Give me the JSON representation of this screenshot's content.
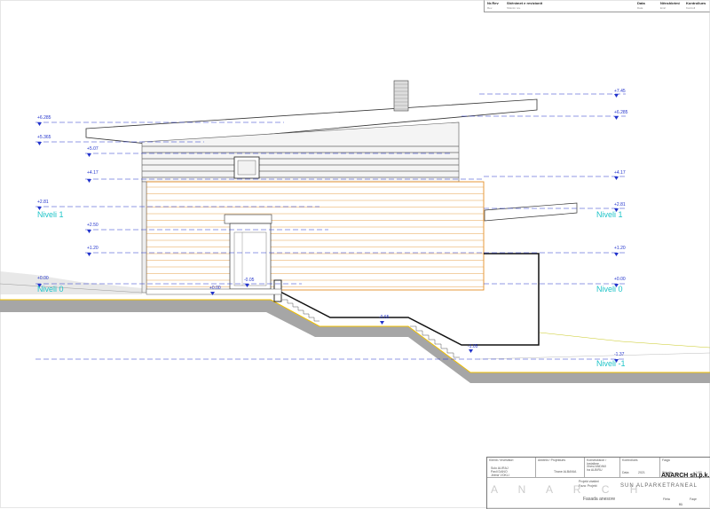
{
  "revision_header": {
    "col_nr": "Nr.Rev",
    "col_desc": "Shënimet e revizionit",
    "col_date": "Data",
    "col_signed": "Nënshkrimi",
    "col_control": "Kontrollues",
    "sub_nr": "Rev.",
    "sub_desc": "Shënim rev.",
    "sub_date": "Data",
    "sub_signed": "Emri",
    "sub_control": "Kontroll"
  },
  "level_labels": [
    {
      "label": "Niveli 1",
      "side": "left"
    },
    {
      "label": "Niveli 1",
      "side": "right"
    },
    {
      "label": "Niveli 0",
      "side": "left"
    },
    {
      "label": "Niveli 0",
      "side": "right"
    },
    {
      "label": "Niveli -1",
      "side": "right"
    }
  ],
  "elevations_left": [
    "+6.285",
    "+5.365",
    "+5.07",
    "+4.17",
    "+2.81",
    "+2.50",
    "+1.20",
    "+0.00"
  ],
  "elevations_right": [
    "+7.45",
    "+6.285",
    "+4.17",
    "+2.81",
    "+1.20",
    "+0.00",
    "-1.37"
  ],
  "elevations_interior": [
    "+0.00",
    "-0.05",
    "-0.65",
    "-1.05"
  ],
  "title_block": {
    "company": "ANARCH sh.p.k.",
    "project_big": "SUN ALPARKETRANEAL",
    "watermark": "A N A R C H",
    "drawing_name": "Fasada anesore",
    "scale_label": "Shkalla",
    "scale_value": "1:50",
    "date_label": "Data",
    "date_value": "2021",
    "sheet_label": "Fleta",
    "sheet_value": "01",
    "row1": [
      "Klienti / Investitori",
      "Arkitekt / Projektues",
      "Konstruksion / Instalime",
      "Kontrollues",
      "Faqja"
    ],
    "names": [
      "Sulo ALIRAJ",
      "Pavli DANO",
      "Jetmir VOKLI",
      "Xhesi ANDIMI",
      "Ira ALBIRU"
    ],
    "small": [
      "Projekt zbatimi",
      "Faza: Projekt",
      "Tirane ALBANIA"
    ],
    "page_label": "Faqe",
    "page_value": "01"
  },
  "colors": {
    "level_text": "#1ec4c8",
    "dim_line": "#2233cc",
    "facade_orange": "#e58e26",
    "ground_gray": "#9a9a9a"
  }
}
